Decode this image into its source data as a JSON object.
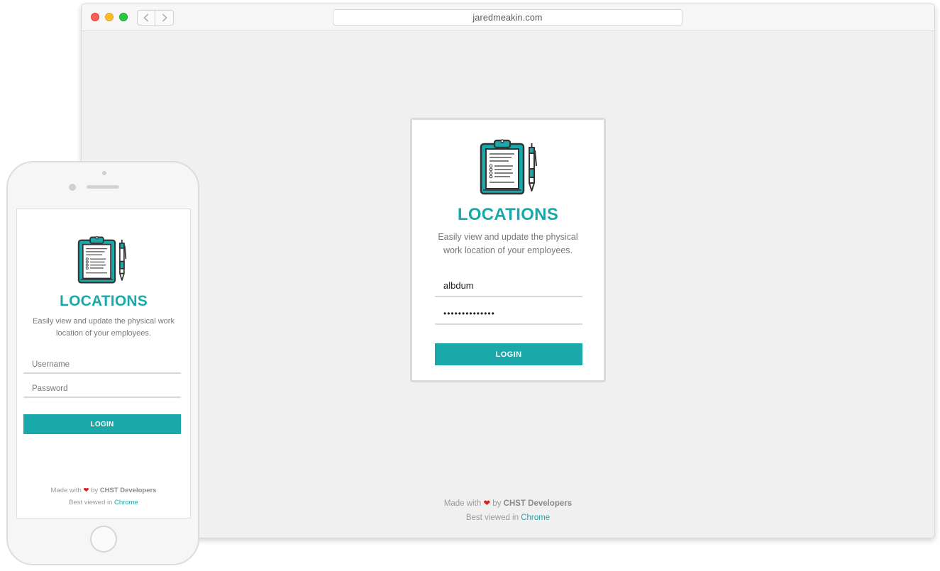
{
  "browser": {
    "url": "jaredmeakin.com"
  },
  "app": {
    "title": "LOCATIONS",
    "description": "Easily view and update the physical work location of your employees.",
    "login_label": "LOGIN",
    "brand_color": "#19a9aa",
    "logo_icon": "clipboard-pen-icon"
  },
  "desktop": {
    "username_value": "albdum",
    "password_value": "••••••••••••••"
  },
  "mobile": {
    "username_placeholder": "Username",
    "password_placeholder": "Password"
  },
  "footer": {
    "made_with": "Made with",
    "by": "by",
    "author": "CHST Developers",
    "best_viewed": "Best viewed in",
    "browser_link": "Chrome"
  }
}
